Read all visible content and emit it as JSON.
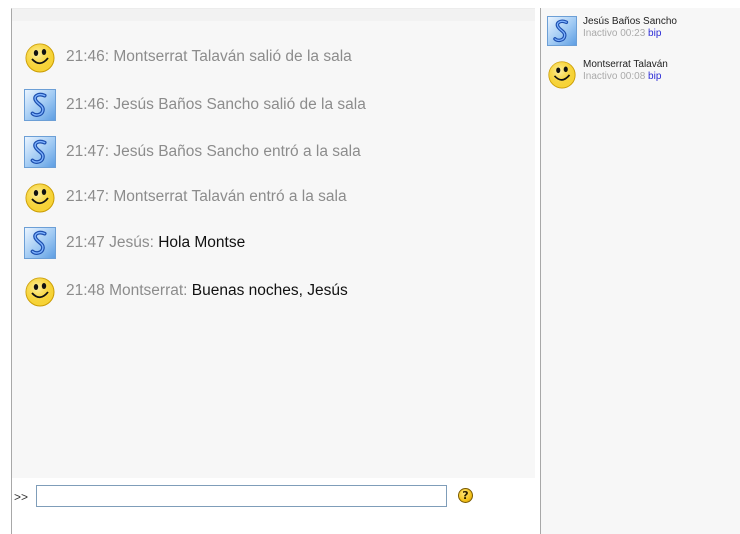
{
  "chat": {
    "messages": [
      {
        "time": "21:46: Montserrat Talaván salió de la sala",
        "body": "",
        "avatar": "smiley-icon"
      },
      {
        "time": "21:46: Jesús Baños Sancho salió de la sala",
        "body": "",
        "avatar": "blue-s-icon"
      },
      {
        "time": "21:47: Jesús Baños Sancho entró a la sala",
        "body": "",
        "avatar": "blue-s-icon"
      },
      {
        "time": "21:47: Montserrat Talaván entró a la sala",
        "body": "",
        "avatar": "smiley-icon"
      },
      {
        "time": "21:47 Jesús: ",
        "body": "Hola Montse",
        "avatar": "blue-s-icon"
      },
      {
        "time": "21:48 Montserrat: ",
        "body": "Buenas noches, Jesús",
        "avatar": "smiley-icon"
      }
    ]
  },
  "input": {
    "prompt": ">>",
    "value": "",
    "help_glyph": "?"
  },
  "users": [
    {
      "name": "Jesús Baños Sancho",
      "status": "Inactivo 00:23",
      "bip": "bip",
      "avatar": "blue-s-icon"
    },
    {
      "name": "Montserrat Talaván",
      "status": "Inactivo 00:08",
      "bip": "bip",
      "avatar": "smiley-icon"
    }
  ],
  "colors": {
    "pane_bg": "#f7f7f7",
    "system_text": "#8c8c8c",
    "message_text": "#111111",
    "bip_link": "#2b2bd6"
  }
}
